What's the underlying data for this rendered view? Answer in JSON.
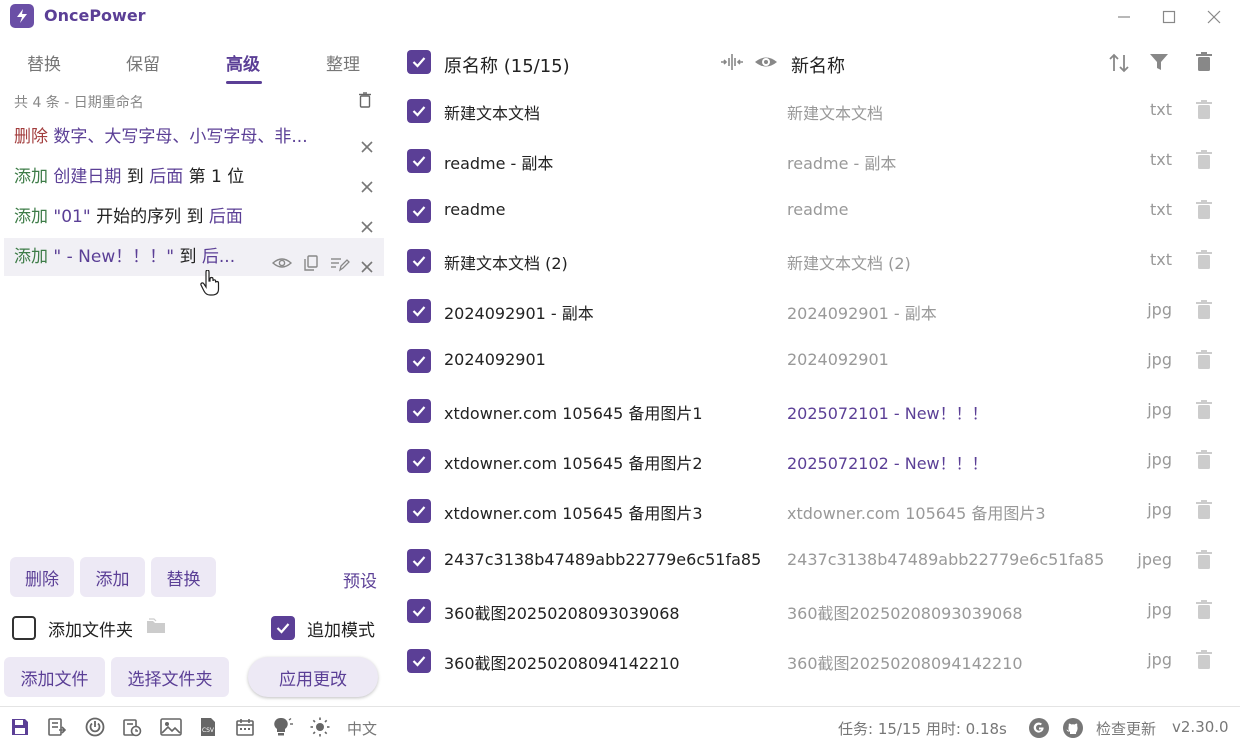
{
  "app": {
    "title": "OncePower"
  },
  "tabs": [
    {
      "label": "替换",
      "active": false
    },
    {
      "label": "保留",
      "active": false
    },
    {
      "label": "高级",
      "active": true
    },
    {
      "label": "整理",
      "active": false
    }
  ],
  "rules": {
    "header": "共 4 条 - 日期重命名",
    "items": [
      {
        "parts": [
          {
            "t": "删除",
            "c": "del"
          },
          {
            "t": " 数字、大写字母、小写字母、非...",
            "c": "purple"
          }
        ]
      },
      {
        "parts": [
          {
            "t": "添加",
            "c": "add"
          },
          {
            "t": " 创建日期",
            "c": "purple"
          },
          {
            "t": " 到 ",
            "c": "plain"
          },
          {
            "t": "后面",
            "c": "purple"
          },
          {
            "t": " 第 1 位",
            "c": "plain"
          }
        ]
      },
      {
        "parts": [
          {
            "t": "添加",
            "c": "add"
          },
          {
            "t": " \"01\"",
            "c": "purple"
          },
          {
            "t": " 开始的序列 到 ",
            "c": "plain"
          },
          {
            "t": "后面",
            "c": "purple"
          }
        ]
      },
      {
        "parts": [
          {
            "t": "添加",
            "c": "add"
          },
          {
            "t": " \" - New！！！\"",
            "c": "purple"
          },
          {
            "t": " 到 ",
            "c": "plain"
          },
          {
            "t": "后...",
            "c": "purple"
          }
        ]
      }
    ]
  },
  "actions": {
    "delete": "删除",
    "add": "添加",
    "replace": "替换",
    "preset": "预设",
    "add_folder": "添加文件夹",
    "append_mode": "追加模式",
    "add_file": "添加文件",
    "select_folder": "选择文件夹",
    "apply": "应用更改"
  },
  "list": {
    "orig_header": "原名称 (15/15)",
    "new_header": "新名称",
    "rows": [
      {
        "orig": "新建文本文档",
        "new": "新建文本文档",
        "changed": false,
        "ext": "txt"
      },
      {
        "orig": "readme - 副本",
        "new": "readme - 副本",
        "changed": false,
        "ext": "txt"
      },
      {
        "orig": "readme",
        "new": "readme",
        "changed": false,
        "ext": "txt"
      },
      {
        "orig": "新建文本文档 (2)",
        "new": "新建文本文档 (2)",
        "changed": false,
        "ext": "txt"
      },
      {
        "orig": "2024092901 - 副本",
        "new": "2024092901 - 副本",
        "changed": false,
        "ext": "jpg"
      },
      {
        "orig": "2024092901",
        "new": "2024092901",
        "changed": false,
        "ext": "jpg"
      },
      {
        "orig": "xtdowner.com 105645 备用图片1",
        "new": "2025072101 - New！！！",
        "changed": true,
        "ext": "jpg"
      },
      {
        "orig": "xtdowner.com 105645 备用图片2",
        "new": "2025072102 - New！！！",
        "changed": true,
        "ext": "jpg"
      },
      {
        "orig": "xtdowner.com 105645 备用图片3",
        "new": "xtdowner.com 105645 备用图片3",
        "changed": false,
        "ext": "jpg"
      },
      {
        "orig": "2437c3138b47489abb22779e6c51fa85",
        "new": "2437c3138b47489abb22779e6c51fa85",
        "changed": false,
        "ext": "jpeg"
      },
      {
        "orig": "360截图20250208093039068",
        "new": "360截图20250208093039068",
        "changed": false,
        "ext": "jpg"
      },
      {
        "orig": "360截图20250208094142210",
        "new": "360截图20250208094142210",
        "changed": false,
        "ext": "jpg"
      }
    ]
  },
  "status": {
    "language": "中文",
    "task_info": "任务: 15/15 用时: 0.18s",
    "check_update": "检查更新",
    "version": "v2.30.0"
  },
  "colors": {
    "accent": "#5b3f96",
    "accent_light": "#ede9f5",
    "add": "#3d7c47",
    "delete": "#a23c3c"
  }
}
